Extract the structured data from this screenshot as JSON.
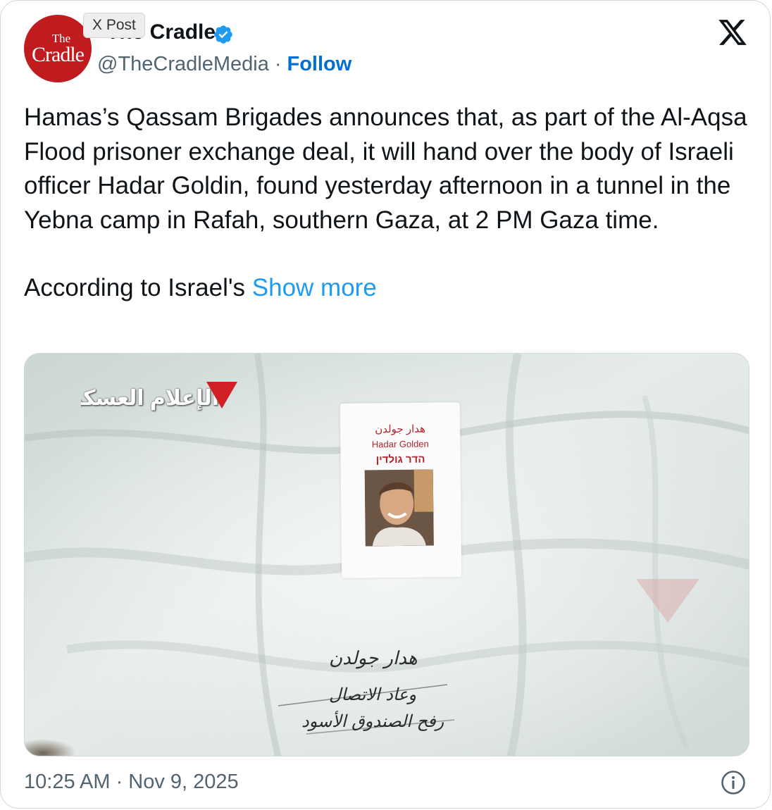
{
  "tooltip": "X Post",
  "author": {
    "avatar_text_top": "The",
    "avatar_text_main": "Cradle",
    "display_name": "The Cradle",
    "handle": "@TheCradleMedia",
    "separator": "·",
    "follow_label": "Follow"
  },
  "colors": {
    "accent_link": "#1d9bf0",
    "follow": "#006fd6",
    "brand_red": "#c01b1f",
    "text_primary": "#0f1419",
    "text_secondary": "#536471"
  },
  "tweet": {
    "paragraph1": "Hamas’s Qassam Brigades announces that, as part of the Al-Aqsa Flood prisoner exchange deal, it will hand over the body of Israeli officer Hadar Goldin, found yesterday afternoon in a tunnel in the Yebna camp in Rafah, southern Gaza, at 2 PM Gaza time.",
    "paragraph2_prefix": "According to Israel's ",
    "show_more_label": "Show more"
  },
  "media": {
    "watermark_text": "الإعلام العسكري",
    "label_arabic": "هدار جولدن",
    "label_english": "Hadar Golden",
    "label_hebrew": "הדר גולדין",
    "handwriting_line1": "هدار جولدن",
    "handwriting_line2": "وعاد الاتصال",
    "handwriting_line3": "رفح الصندوق الأسود"
  },
  "footer": {
    "timestamp": "10:25 AM · Nov 9, 2025"
  },
  "icons": {
    "verified": "verified-badge-icon",
    "x_logo": "x-logo-icon",
    "info": "info-icon"
  }
}
